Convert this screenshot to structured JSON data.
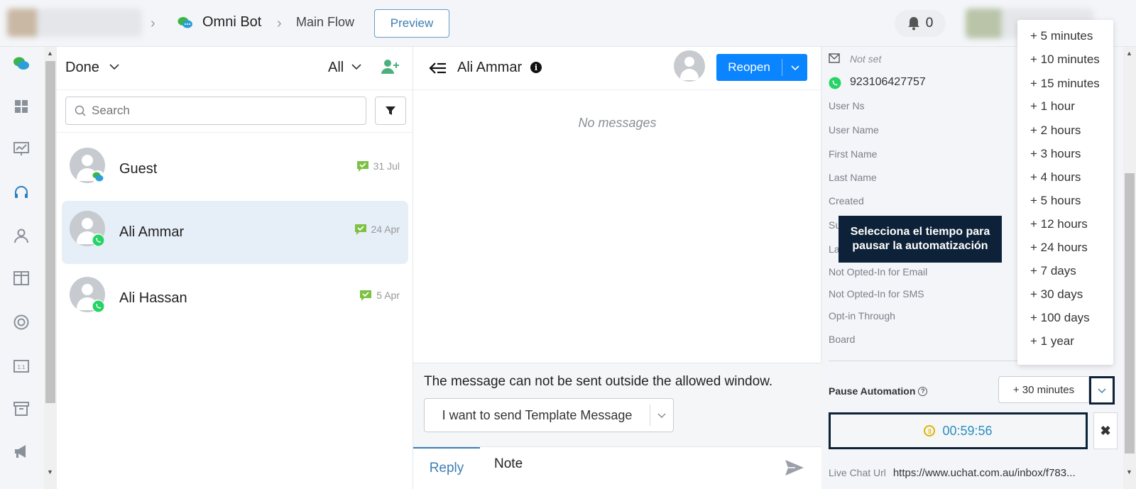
{
  "header": {
    "bot_name": "Omni Bot",
    "flow_name": "Main Flow",
    "preview_label": "Preview",
    "notification_count": "0"
  },
  "nav": {
    "icons": [
      "chat-bubbles-icon",
      "dashboard-grid-icon",
      "analytics-chart-icon",
      "headset-icon",
      "user-icon",
      "columns-icon",
      "lifebuoy-icon",
      "template-icon",
      "archive-icon",
      "megaphone-icon"
    ]
  },
  "conversations": {
    "status_filter": "Done",
    "scope_filter": "All",
    "search_placeholder": "Search",
    "items": [
      {
        "name": "Guest",
        "date": "31 Jul",
        "channel": "webchat"
      },
      {
        "name": "Ali Ammar",
        "date": "24 Apr",
        "channel": "whatsapp"
      },
      {
        "name": "Ali Hassan",
        "date": "5 Apr",
        "channel": "whatsapp"
      }
    ]
  },
  "chat": {
    "contact_name": "Ali Ammar",
    "reopen_label": "Reopen",
    "empty_text": "No messages",
    "window_warning": "The message can not be sent outside the allowed window.",
    "template_select": "I want to send Template Message",
    "tab_reply": "Reply",
    "tab_note": "Note"
  },
  "profile": {
    "email": "Not set",
    "phone": "923106427757",
    "fields": [
      "User Ns",
      "User Name",
      "First Name",
      "Last Name",
      "Created",
      "Su",
      "La",
      "Not Opted-In for Email",
      "Not Opted-In for SMS",
      "Opt-in Through",
      "Board"
    ],
    "pause_label": "Pause Automation",
    "pause_value": "+ 30 minutes",
    "timer": "00:59:56",
    "live_chat_label": "Live Chat Url",
    "live_chat_url": "https://www.uchat.com.au/inbox/f783..."
  },
  "tooltip": "Selecciona el tiempo para pausar la automatización",
  "pause_options": [
    "+ 5 minutes",
    "+ 10 minutes",
    "+ 15 minutes",
    "+ 1 hour",
    "+ 2 hours",
    "+ 3 hours",
    "+ 4 hours",
    "+ 5 hours",
    "+ 12 hours",
    "+ 24 hours",
    "+ 7 days",
    "+ 30 days",
    "+ 100 days",
    "+ 1 year"
  ],
  "colors": {
    "accent": "#0a84ff",
    "whatsapp": "#25d366",
    "tooltip_bg": "#0d2238",
    "timer_text": "#2a8fbf"
  }
}
